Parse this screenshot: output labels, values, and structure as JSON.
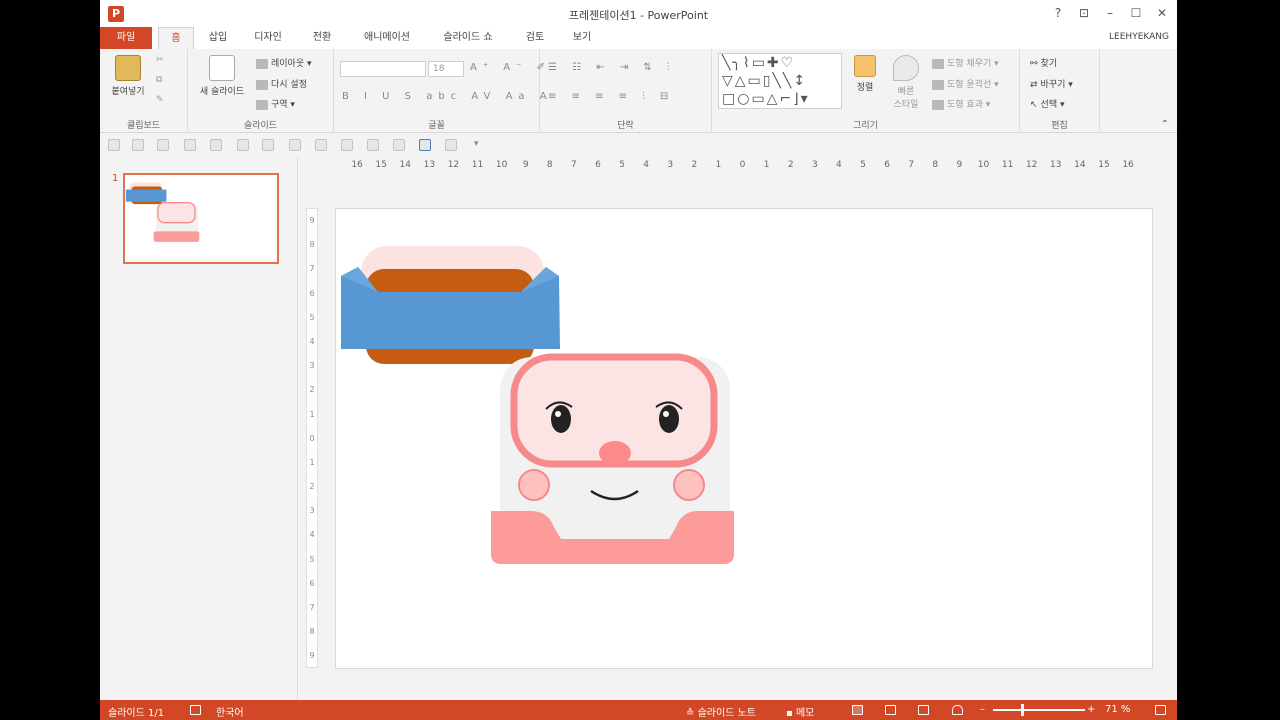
{
  "window": {
    "title": "프레젠테이션1 - PowerPoint",
    "app_icon_letter": "P",
    "controls": [
      "?",
      "⊡",
      "–",
      "☐",
      "✕"
    ]
  },
  "tabs": [
    "파일",
    "홈",
    "삽입",
    "디자인",
    "전환",
    "애니메이션",
    "슬라이드 쇼",
    "검토",
    "보기"
  ],
  "user_name": "LEEHYEKANG",
  "ribbon": {
    "clipboard": {
      "paste": "붙여넣기",
      "label": "클립보드"
    },
    "slides": {
      "new_slide": "새 슬라이드",
      "layout": "레이아웃 ▾",
      "reset": "다시 설정",
      "section": "구역 ▾",
      "label": "슬라이드"
    },
    "font": {
      "size": "18",
      "label": "글꼴"
    },
    "paragraph": {
      "label": "단락"
    },
    "drawing": {
      "arrange": "정렬",
      "quick_styles": "빠른\n스타일",
      "fill": "도형 채우기 ▾",
      "outline": "도형 윤곽선 ▾",
      "effects": "도형 효과 ▾",
      "label": "그리기"
    },
    "editing": {
      "find": "찾기",
      "replace": "바꾸기 ▾",
      "select": "선택 ▾",
      "label": "편집"
    }
  },
  "thumbnail": {
    "slide_number": "1"
  },
  "ruler": {
    "horizontal": [
      "16",
      "15",
      "14",
      "13",
      "12",
      "11",
      "10",
      "9",
      "8",
      "7",
      "6",
      "5",
      "4",
      "3",
      "2",
      "1",
      "0",
      "1",
      "2",
      "3",
      "4",
      "5",
      "6",
      "7",
      "8",
      "9",
      "10",
      "11",
      "12",
      "13",
      "14",
      "15",
      "16"
    ],
    "vertical": [
      "9",
      "8",
      "7",
      "6",
      "5",
      "4",
      "3",
      "2",
      "1",
      "0",
      "1",
      "2",
      "3",
      "4",
      "5",
      "6",
      "7",
      "8",
      "9"
    ]
  },
  "statusbar": {
    "slide": "슬라이드 1/1",
    "language": "한국어",
    "notes": "슬라이드 노트",
    "comments": "메모",
    "zoom": "71 %",
    "zoom_minus": "–",
    "zoom_plus": "+"
  },
  "colors": {
    "accent": "#d24726",
    "character_body": "#f1f1f1",
    "character_face": "#fde4e4",
    "character_outline": "#f68a8a",
    "character_base": "#fd9b9b",
    "hat_blue": "#5797d3",
    "hat_brown": "#c65c12",
    "hat_pink": "#fde2e2"
  }
}
